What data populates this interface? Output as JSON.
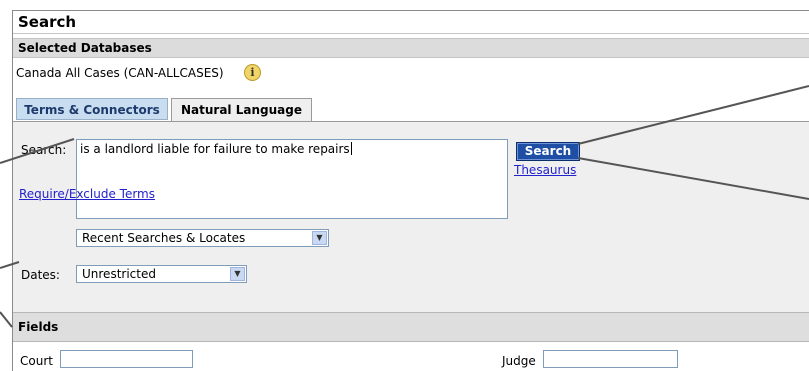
{
  "header": {
    "title": "Search"
  },
  "databases": {
    "section_label": "Selected Databases",
    "database_name": "Canada All Cases (CAN-ALLCASES)",
    "info_icon": "info-icon",
    "info_glyph": "i"
  },
  "tabs": [
    {
      "label": "Terms & Connectors",
      "active": false
    },
    {
      "label": "Natural Language",
      "active": true
    }
  ],
  "search": {
    "label": "Search:",
    "query": "is a landlord liable for failure to make repairs",
    "button_label": "Search",
    "thesaurus_label": "Thesaurus",
    "recent_select_value": "Recent Searches & Locates"
  },
  "dates": {
    "label": "Dates:",
    "selected": "Unrestricted"
  },
  "require_exclude_label": "Require/Exclude Terms",
  "fields": {
    "section_label": "Fields",
    "court_label": "Court",
    "judge_label": "Judge"
  },
  "icons": {
    "dropdown_arrow": "chevron-down-icon"
  },
  "colors": {
    "search_button": "#1f4fa5",
    "link": "#2222cc",
    "tab_inactive": "#c9ddf0",
    "callout_line": "#555555"
  }
}
